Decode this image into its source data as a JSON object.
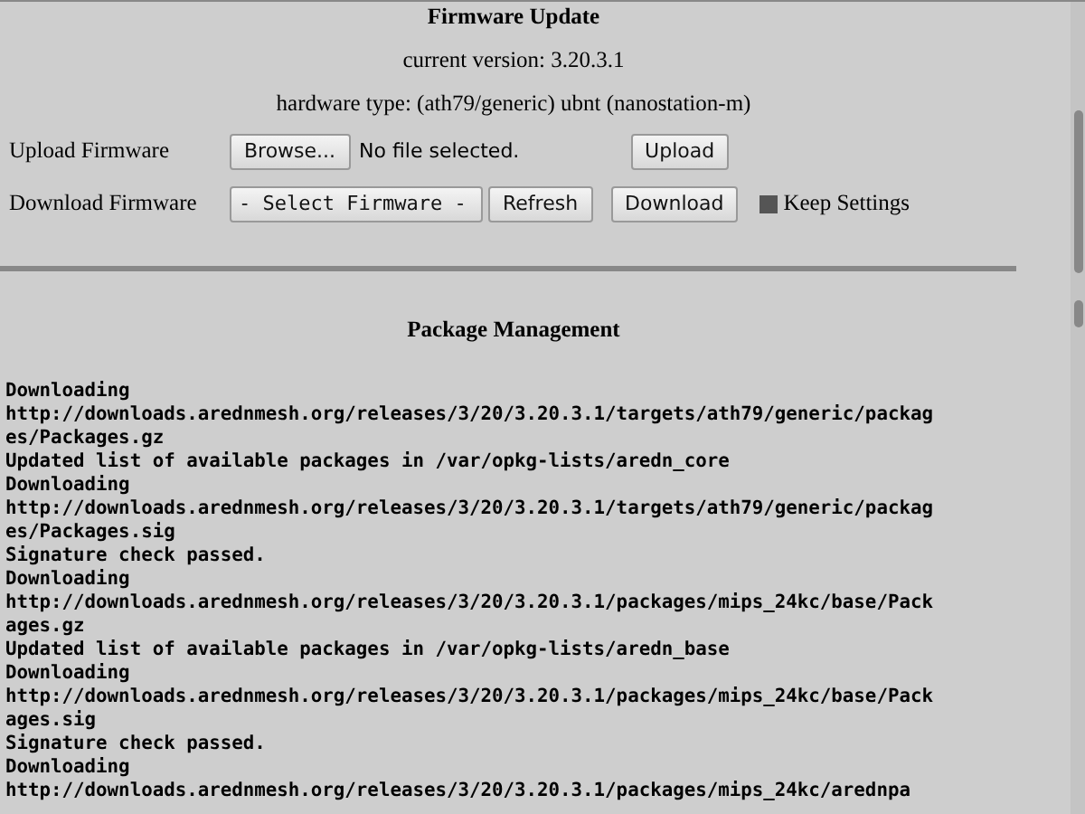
{
  "firmware": {
    "title": "Firmware Update",
    "current_version": "current version: 3.20.3.1",
    "hardware_type": "hardware type: (ath79/generic) ubnt (nanostation-m)",
    "upload": {
      "label": "Upload Firmware",
      "browse_button": "Browse...",
      "file_status": "No file selected.",
      "upload_button": "Upload"
    },
    "download": {
      "label": "Download Firmware",
      "select": "- Select Firmware -",
      "refresh_button": "Refresh",
      "download_button": "Download",
      "keep_settings": {
        "label": "Keep Settings",
        "checked": true
      }
    }
  },
  "packages": {
    "title": "Package Management",
    "log": [
      "Downloading",
      "http://downloads.arednmesh.org/releases/3/20/3.20.3.1/targets/ath79/generic/packages/Packages.gz",
      "Updated list of available packages in /var/opkg-lists/aredn_core",
      "Downloading",
      "http://downloads.arednmesh.org/releases/3/20/3.20.3.1/targets/ath79/generic/packages/Packages.sig",
      "Signature check passed.",
      "Downloading",
      "http://downloads.arednmesh.org/releases/3/20/3.20.3.1/packages/mips_24kc/base/Packages.gz",
      "Updated list of available packages in /var/opkg-lists/aredn_base",
      "Downloading",
      "http://downloads.arednmesh.org/releases/3/20/3.20.3.1/packages/mips_24kc/base/Packages.sig",
      "Signature check passed.",
      "Downloading",
      "http://downloads.arednmesh.org/releases/3/20/3.20.3.1/packages/mips_24kc/arednpa"
    ]
  }
}
